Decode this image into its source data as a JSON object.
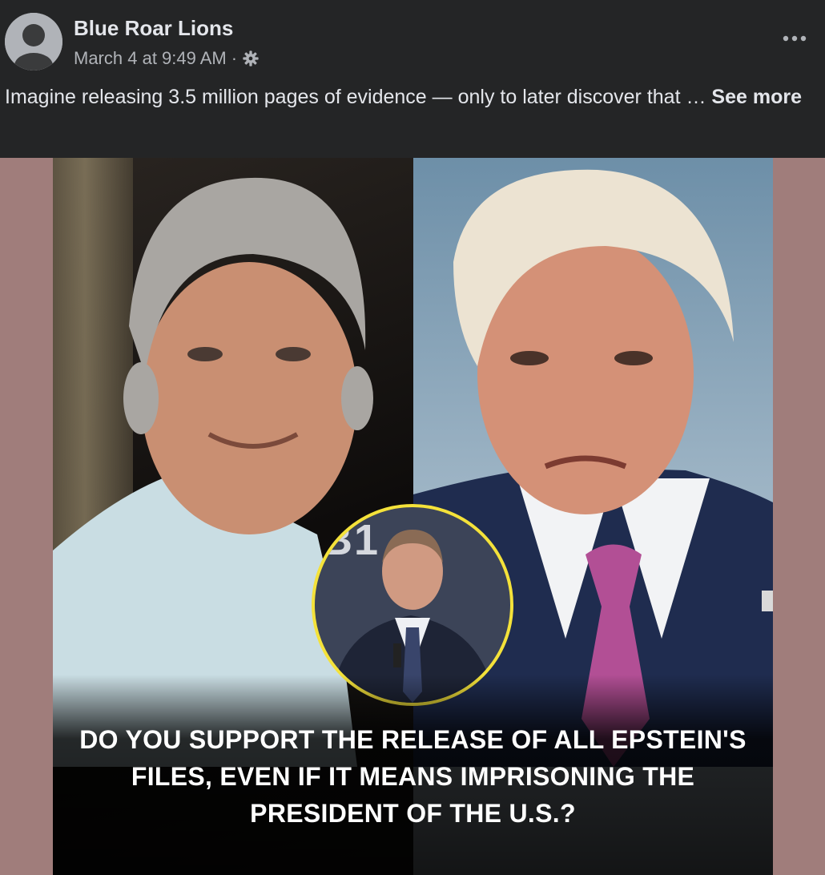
{
  "post": {
    "author": "Blue Roar Lions",
    "timestamp": "March 4 at 9:49 AM",
    "separator": "·",
    "audience_icon": "gear-icon",
    "more_icon": "more-options-icon",
    "body_text": "Imagine releasing 3.5 million pages of evidence — only to later discover that …",
    "see_more_label": "See more"
  },
  "media": {
    "inset_backdrop_text": "B1",
    "caption": "DO YOU SUPPORT THE RELEASE OF ALL EPSTEIN'S FILES, EVEN IF IT MEANS IMPRISONING THE PRESIDENT OF THE U.S.?",
    "inset_border_color": "#f4e23a",
    "side_bar_color": "#a07d7b"
  },
  "colors": {
    "background": "#242526",
    "primary_text": "#e4e6eb",
    "secondary_text": "#b0b3b8"
  }
}
